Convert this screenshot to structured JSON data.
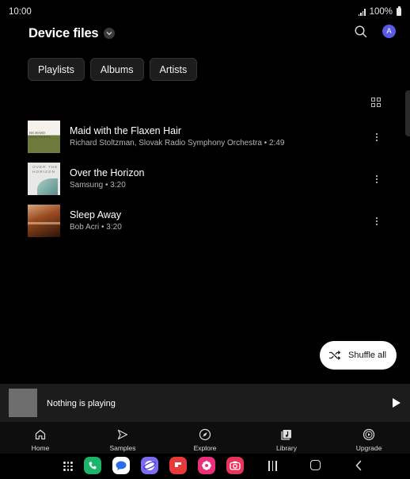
{
  "status_bar": {
    "time": "10:00",
    "battery": "100%"
  },
  "header": {
    "title": "Device files",
    "avatar_letter": "A"
  },
  "chips": [
    {
      "label": "Playlists"
    },
    {
      "label": "Albums"
    },
    {
      "label": "Artists"
    }
  ],
  "tracks": [
    {
      "title": "Maid with the Flaxen Hair",
      "subtitle": "Richard Stoltzman, Slovak Radio Symphony Orchestra • 2:49",
      "cover_text": "RICHARD STOLTZMAN"
    },
    {
      "title": "Over the Horizon",
      "subtitle": "Samsung • 3:20",
      "cover_text": "OVER THE HORIZON"
    },
    {
      "title": "Sleep Away",
      "subtitle": "Bob Acri • 3:20",
      "cover_text": ""
    }
  ],
  "shuffle": {
    "label": "Shuffle all"
  },
  "mini_player": {
    "text": "Nothing is playing"
  },
  "bottom_nav": [
    {
      "label": "Home",
      "icon": "home-icon"
    },
    {
      "label": "Samples",
      "icon": "samples-icon"
    },
    {
      "label": "Explore",
      "icon": "compass-icon"
    },
    {
      "label": "Library",
      "icon": "library-icon"
    },
    {
      "label": "Upgrade",
      "icon": "upgrade-icon"
    }
  ],
  "dock_apps": [
    {
      "name": "phone-app-icon",
      "color": "#1db46c"
    },
    {
      "name": "messages-app-icon",
      "color": "#ffffff"
    },
    {
      "name": "internet-app-icon",
      "color": "#7b6cf0"
    },
    {
      "name": "flipboard-app-icon",
      "color": "#e83a3a"
    },
    {
      "name": "gallery-app-icon",
      "color": "#e8317a"
    },
    {
      "name": "camera-app-icon",
      "color": "#e8345a"
    }
  ]
}
